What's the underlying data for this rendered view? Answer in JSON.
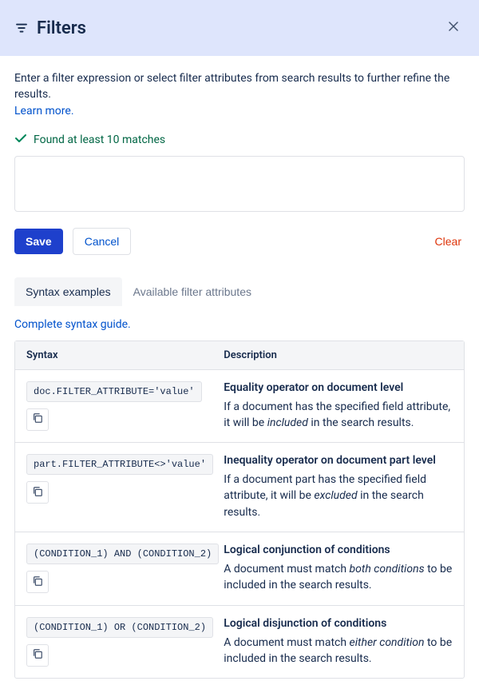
{
  "header": {
    "title": "Filters"
  },
  "intro": "Enter a filter expression or select filter attributes from search results to further refine the results.",
  "learn_more": "Learn more.",
  "status": "Found at least 10 matches",
  "buttons": {
    "save": "Save",
    "cancel": "Cancel",
    "clear": "Clear"
  },
  "tabs": {
    "syntax": "Syntax examples",
    "attributes": "Available filter attributes"
  },
  "syntax_guide": "Complete syntax guide.",
  "table": {
    "col_syntax": "Syntax",
    "col_description": "Description",
    "rows": [
      {
        "code": "doc.FILTER_ATTRIBUTE='value'",
        "title": "Equality operator on document level",
        "text_pre": "If a document has the specified field attribute, it will be ",
        "text_em": "included",
        "text_post": " in the search results."
      },
      {
        "code": "part.FILTER_ATTRIBUTE<>'value'",
        "title": "Inequality operator on document part level",
        "text_pre": "If a document part has the specified field attribute, it will be ",
        "text_em": "excluded",
        "text_post": " in the search results."
      },
      {
        "code": "(CONDITION_1) AND (CONDITION_2)",
        "title": "Logical conjunction of conditions",
        "text_pre": "A document must match ",
        "text_em": "both conditions",
        "text_post": " to be included in the search results."
      },
      {
        "code": "(CONDITION_1) OR (CONDITION_2)",
        "title": "Logical disjunction of conditions",
        "text_pre": "A document must match ",
        "text_em": "either condition",
        "text_post": " to be included in the search results."
      }
    ]
  }
}
